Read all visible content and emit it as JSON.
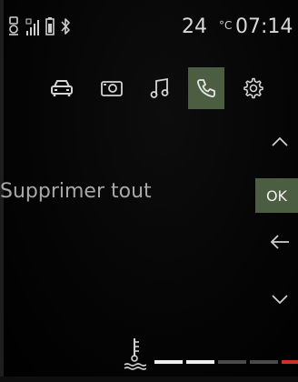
{
  "status": {
    "temperature": "24",
    "temperature_unit": "°C",
    "time": "07:14",
    "icons": [
      "key-fob-icon",
      "signal-strength-icon",
      "phone-battery-icon",
      "bluetooth-icon"
    ]
  },
  "tabs": [
    {
      "name": "car",
      "icon": "car-icon",
      "active": false
    },
    {
      "name": "media",
      "icon": "radio-icon",
      "active": false
    },
    {
      "name": "music",
      "icon": "music-note-icon",
      "active": false
    },
    {
      "name": "phone",
      "icon": "phone-icon",
      "active": true
    },
    {
      "name": "settings",
      "icon": "gear-icon",
      "active": false
    }
  ],
  "menu": {
    "current_item": "Supprimer tout",
    "ok_label": "OK"
  },
  "controls": {
    "up": "chevron-up-icon",
    "back": "arrow-left-icon",
    "down": "chevron-down-icon"
  },
  "coolant": {
    "icon": "coolant-temperature-icon",
    "segments": [
      "#f0f0f0",
      "#f0f0f0",
      "#4a4a4a",
      "#4a4a4a",
      "#d0302a"
    ]
  },
  "colors": {
    "accent": "#4b5e42",
    "text": "#d7d7d7",
    "warning": "#d0302a"
  }
}
